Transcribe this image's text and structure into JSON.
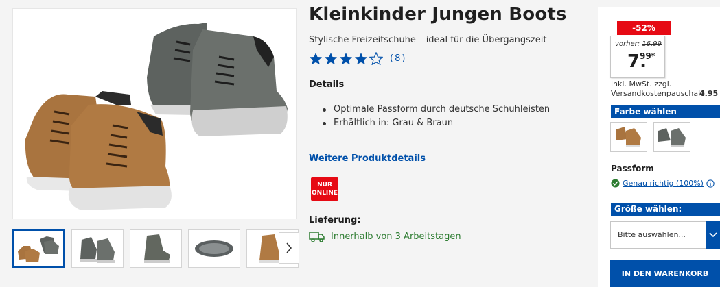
{
  "product": {
    "title": "Kleinkinder Jungen Boots",
    "subtitle": "Stylische Freizeitschuhe – ideal für die Übergangszeit",
    "rating": {
      "stars": 4,
      "max": 5,
      "count": "8",
      "open_paren": "(",
      "close_paren": ")"
    },
    "details_heading": "Details",
    "details": [
      "Optimale Passform durch deutsche Schuhleisten",
      "Erhältlich in: Grau & Braun"
    ],
    "more_details_link": "Weitere Produktdetails",
    "online_badge": {
      "line1": "NUR",
      "line2": "ONLINE"
    },
    "delivery_heading": "Lieferung:",
    "delivery_text": "Innerhalb von 3 Arbeitstagen"
  },
  "gallery": {
    "thumbnails": [
      "brown-and-grey-pair",
      "grey-side-pair",
      "grey-single",
      "sole-view",
      "brown-single"
    ],
    "active_index": 0,
    "next_icon": "chevron-right-icon"
  },
  "pricing": {
    "discount": "-52%",
    "old_prefix": "vorher:",
    "old_price": "16.99",
    "price_main": "7.",
    "price_cents": "99",
    "price_star": "*",
    "tax_note": "inkl. MwSt. zzgl.",
    "shipping_label": "Versandkostenpauschale",
    "shipping_price": "4.95"
  },
  "options": {
    "color_heading": "Farbe wählen",
    "colors": [
      "braun",
      "grau"
    ],
    "fit_heading": "Passform",
    "fit_value": "Genau richtig (100%)",
    "size_heading": "Größe wählen:",
    "size_placeholder": "Bitte auswählen...",
    "cart_button": "IN DEN WARENKORB"
  },
  "colors": {
    "brand_blue": "#0050aa",
    "sale_red": "#e60a14",
    "success_green": "#2e7d32"
  }
}
